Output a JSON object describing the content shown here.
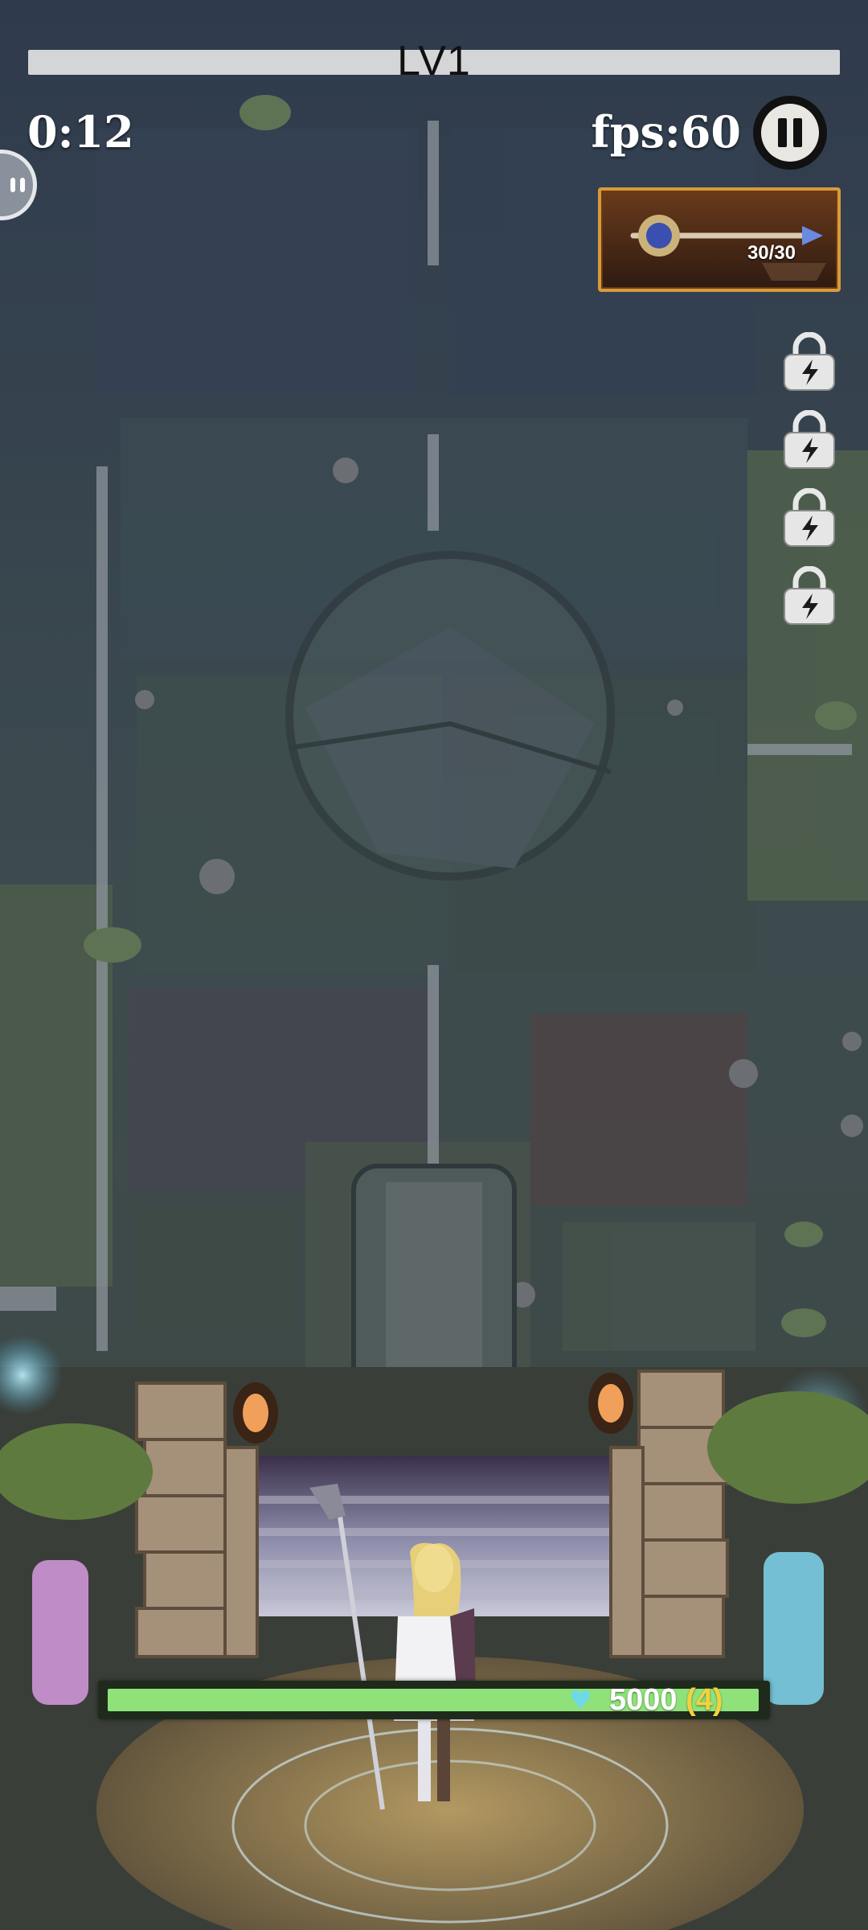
{
  "hud": {
    "level": "LV1",
    "timer": "0:12",
    "fps": "fps:60",
    "xp_progress": 0
  },
  "weapon": {
    "name_icon": "magic-staff-icon",
    "ammo": "30/30"
  },
  "skill_slots": [
    {
      "state": "locked",
      "icon": "lock-lightning-icon"
    },
    {
      "state": "locked",
      "icon": "lock-lightning-icon"
    },
    {
      "state": "locked",
      "icon": "lock-lightning-icon"
    },
    {
      "state": "locked",
      "icon": "lock-lightning-icon"
    }
  ],
  "base": {
    "hp_value": "5000",
    "hp_bonus": "(4)",
    "hp_fraction": 1.0,
    "heart_icon": "heart-icon"
  },
  "colors": {
    "hp_fill": "#8fe27a",
    "hp_bonus": "#f2d23d",
    "rune_glow": "#7fd6f0",
    "weapon_frame": "#d99a3a"
  }
}
